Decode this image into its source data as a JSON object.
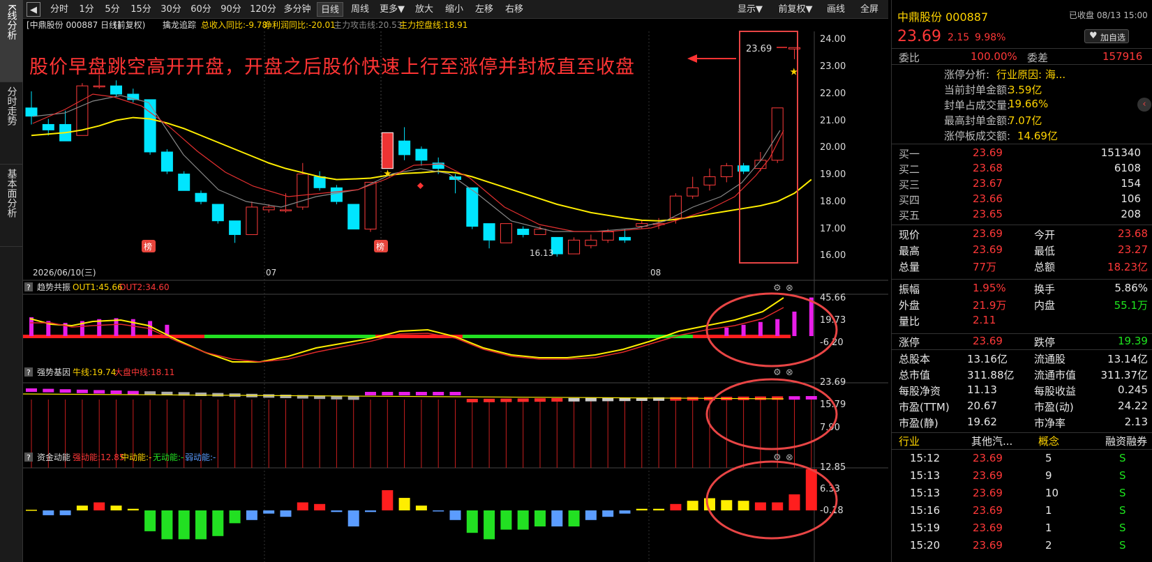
{
  "toolbar": {
    "items": [
      "分时",
      "1分",
      "5分",
      "15分",
      "30分",
      "60分",
      "90分",
      "120分",
      "多分钟",
      "日线",
      "周线",
      "更多▼",
      "放大",
      "缩小",
      "左移",
      "右移",
      "显示▼",
      "前复权▼",
      "画线",
      "全屏"
    ]
  },
  "leftbar": {
    "tabs": [
      "K线分析",
      "分时走势",
      "基本面分析"
    ]
  },
  "main_panel": {
    "header_left": "[中鼎股份 000887 日线]",
    "header_adj": "(前复权)",
    "indicator_name": "擒龙追踪",
    "ind1": "总收入同比:-9.78",
    "ind2": "净利润同比:-20.01",
    "ind3": "主力攻击线:20.53",
    "ind4": "主力控盘线:18.91",
    "annotation": "股价早盘跳空高开开盘，开盘之后股价快速上行至涨停并封板直至收盘",
    "last_price_label": "23.69",
    "low_label": "16.13",
    "rank_badge": "榜",
    "date_label": "2026/06/10(三)",
    "month_labels": [
      "07",
      "08"
    ],
    "y_ticks": [
      "24.00",
      "23.00",
      "22.00",
      "21.00",
      "20.00",
      "19.00",
      "18.00",
      "17.00",
      "16.00"
    ]
  },
  "sub1": {
    "name": "趋势共振",
    "out1": "OUT1:45.66",
    "out2": "OUT2:34.60",
    "ticks": [
      "45.66",
      "19.73",
      "-6.20"
    ]
  },
  "sub2": {
    "name": "强势基因",
    "l1": "牛线:19.74",
    "l2": "大盘中线:18.11",
    "ticks": [
      "23.69",
      "15.79",
      "7.90"
    ]
  },
  "sub3": {
    "name": "资金动能",
    "l1": "强动能:12.85",
    "l2": "中动能:-",
    "l3": "无动能:-",
    "l4": "弱动能:-",
    "ticks": [
      "12.85",
      "6.33",
      "-0.18"
    ]
  },
  "right": {
    "stock_name": "中鼎股份 000887",
    "status": "已收盘 08/13 15:00",
    "price": "23.69",
    "change": "2.15",
    "pct": "9.98%",
    "watch": "加自选",
    "webi_label": "委比",
    "webi": "100.00%",
    "weicha_label": "委差",
    "weicha": "157916",
    "limit_info": [
      {
        "k": "涨停分析:",
        "v": "行业原因: 海..."
      },
      {
        "k": "当前封单金额:",
        "v": "3.59亿"
      },
      {
        "k": "封单占成交量:",
        "v": "19.66%"
      },
      {
        "k": "最高封单金额:",
        "v": "7.07亿"
      },
      {
        "k": "涨停板成交额:",
        "v": "14.69亿"
      }
    ],
    "bids": [
      {
        "l": "买一",
        "p": "23.69",
        "v": "151340"
      },
      {
        "l": "买二",
        "p": "23.68",
        "v": "6108"
      },
      {
        "l": "买三",
        "p": "23.67",
        "v": "154"
      },
      {
        "l": "买四",
        "p": "23.66",
        "v": "106"
      },
      {
        "l": "买五",
        "p": "23.65",
        "v": "208"
      }
    ],
    "stats1": [
      {
        "k1": "现价",
        "v1": "23.69",
        "k2": "今开",
        "v2": "23.68"
      },
      {
        "k1": "最高",
        "v1": "23.69",
        "k2": "最低",
        "v2": "23.27"
      },
      {
        "k1": "总量",
        "v1": "77万",
        "k2": "总额",
        "v2": "18.23亿"
      }
    ],
    "stats2": [
      {
        "k1": "振幅",
        "v1": "1.95%",
        "k2": "换手",
        "v2": "5.86%"
      },
      {
        "k1": "外盘",
        "v1": "21.9万",
        "k2": "内盘",
        "v2": "55.1万"
      },
      {
        "k1": "量比",
        "v1": "2.11",
        "k2": "",
        "v2": ""
      }
    ],
    "limits": {
      "k1": "涨停",
      "v1": "23.69",
      "k2": "跌停",
      "v2": "19.39"
    },
    "fundamentals": [
      {
        "k1": "总股本",
        "v1": "13.16亿",
        "k2": "流通股",
        "v2": "13.14亿"
      },
      {
        "k1": "总市值",
        "v1": "311.88亿",
        "k2": "流通市值",
        "v2": "311.37亿"
      },
      {
        "k1": "每股净资",
        "v1": "11.13",
        "k2": "每股收益",
        "v2": "0.245"
      },
      {
        "k1": "市盈(TTM)",
        "v1": "20.67",
        "k2": "市盈(动)",
        "v2": "24.22"
      },
      {
        "k1": "市盈(静)",
        "v1": "19.62",
        "k2": "市净率",
        "v2": "2.13"
      }
    ],
    "industry": {
      "k1": "行业",
      "v1": "其他汽...",
      "k2": "概念",
      "v2": "融资融券"
    },
    "ticks": [
      {
        "t": "15:12",
        "p": "23.69",
        "v": "5",
        "d": "S"
      },
      {
        "t": "15:13",
        "p": "23.69",
        "v": "9",
        "d": "S"
      },
      {
        "t": "15:13",
        "p": "23.69",
        "v": "10",
        "d": "S"
      },
      {
        "t": "15:16",
        "p": "23.69",
        "v": "1",
        "d": "S"
      },
      {
        "t": "15:19",
        "p": "23.69",
        "v": "1",
        "d": "S"
      },
      {
        "t": "15:20",
        "p": "23.69",
        "v": "2",
        "d": "S"
      }
    ]
  },
  "chart_data": {
    "type": "candlestick",
    "ylim": [
      16,
      24
    ],
    "candles": [
      {
        "o": 21.5,
        "c": 21.2,
        "h": 22.1,
        "l": 20.9
      },
      {
        "o": 20.9,
        "c": 20.7,
        "h": 21.1,
        "l": 20.5
      },
      {
        "o": 20.9,
        "c": 20.3,
        "h": 21.4,
        "l": 20.3
      },
      {
        "o": 20.5,
        "c": 22.3,
        "h": 22.4,
        "l": 20.5
      },
      {
        "o": 22.3,
        "c": 22.3,
        "h": 22.7,
        "l": 22.2
      },
      {
        "o": 22.3,
        "c": 22.0,
        "h": 22.5,
        "l": 21.9
      },
      {
        "o": 22.0,
        "c": 21.8,
        "h": 22.2,
        "l": 21.7
      },
      {
        "o": 21.8,
        "c": 19.9,
        "h": 21.8,
        "l": 19.8
      },
      {
        "o": 19.9,
        "c": 19.2,
        "h": 20.0,
        "l": 19.1
      },
      {
        "o": 19.1,
        "c": 18.5,
        "h": 19.2,
        "l": 18.5
      },
      {
        "o": 18.4,
        "c": 18.1,
        "h": 18.5,
        "l": 18.0
      },
      {
        "o": 18.0,
        "c": 17.4,
        "h": 18.0,
        "l": 17.3
      },
      {
        "o": 17.4,
        "c": 16.9,
        "h": 17.4,
        "l": 16.6
      },
      {
        "o": 16.9,
        "c": 17.9,
        "h": 18.1,
        "l": 16.9
      },
      {
        "o": 17.8,
        "c": 17.9,
        "h": 18.0,
        "l": 17.7
      },
      {
        "o": 17.8,
        "c": 17.8,
        "h": 18.4,
        "l": 17.7
      },
      {
        "o": 17.9,
        "c": 19.1,
        "h": 19.5,
        "l": 17.8
      },
      {
        "o": 19.0,
        "c": 18.6,
        "h": 19.2,
        "l": 18.5
      },
      {
        "o": 18.6,
        "c": 18.1,
        "h": 18.7,
        "l": 18.0
      },
      {
        "o": 18.0,
        "c": 17.1,
        "h": 18.0,
        "l": 17.1
      },
      {
        "o": 17.1,
        "c": 18.8,
        "h": 18.8,
        "l": 17.0
      },
      {
        "o": 19.3,
        "c": 20.6,
        "h": 20.6,
        "l": 19.3
      },
      {
        "o": 20.3,
        "c": 19.8,
        "h": 20.8,
        "l": 19.6
      },
      {
        "o": 20.0,
        "c": 19.6,
        "h": 20.1,
        "l": 19.4
      },
      {
        "o": 19.5,
        "c": 19.3,
        "h": 19.7,
        "l": 19.1
      },
      {
        "o": 19.0,
        "c": 18.9,
        "h": 19.1,
        "l": 18.4
      },
      {
        "o": 18.6,
        "c": 17.2,
        "h": 18.6,
        "l": 17.1
      },
      {
        "o": 17.3,
        "c": 16.7,
        "h": 17.3,
        "l": 16.4
      },
      {
        "o": 16.6,
        "c": 17.3,
        "h": 17.3,
        "l": 16.6
      },
      {
        "o": 17.1,
        "c": 16.9,
        "h": 17.2,
        "l": 16.8
      },
      {
        "o": 16.9,
        "c": 17.1,
        "h": 17.2,
        "l": 16.9
      },
      {
        "o": 16.8,
        "c": 16.2,
        "h": 16.8,
        "l": 16.1
      },
      {
        "o": 16.2,
        "c": 16.7,
        "h": 16.8,
        "l": 16.2
      },
      {
        "o": 16.5,
        "c": 16.7,
        "h": 16.9,
        "l": 16.4
      },
      {
        "o": 16.7,
        "c": 17.0,
        "h": 17.1,
        "l": 16.6
      },
      {
        "o": 16.8,
        "c": 16.7,
        "h": 17.1,
        "l": 16.6
      },
      {
        "o": 17.2,
        "c": 17.3,
        "h": 17.4,
        "l": 17.1
      },
      {
        "o": 17.3,
        "c": 17.3,
        "h": 17.5,
        "l": 17.1
      },
      {
        "o": 17.5,
        "c": 18.3,
        "h": 18.4,
        "l": 17.3
      },
      {
        "o": 18.3,
        "c": 18.6,
        "h": 19.0,
        "l": 18.2
      },
      {
        "o": 18.7,
        "c": 19.0,
        "h": 19.3,
        "l": 18.5
      },
      {
        "o": 19.0,
        "c": 19.4,
        "h": 19.5,
        "l": 18.8
      },
      {
        "o": 19.4,
        "c": 19.2,
        "h": 19.5,
        "l": 19.1
      },
      {
        "o": 19.3,
        "c": 19.6,
        "h": 19.9,
        "l": 19.2
      },
      {
        "o": 19.6,
        "c": 21.5,
        "h": 21.5,
        "l": 19.5
      },
      {
        "o": 23.68,
        "c": 23.69,
        "h": 23.69,
        "l": 23.27
      }
    ],
    "ma_yellow": [
      20.5,
      20.55,
      20.6,
      20.7,
      20.85,
      21.05,
      21.15,
      21.1,
      20.95,
      20.75,
      20.5,
      20.25,
      20.0,
      19.75,
      19.5,
      19.3,
      19.15,
      19.0,
      18.9,
      18.92,
      18.95,
      19.05,
      19.12,
      19.15,
      19.2,
      19.15,
      19.0,
      18.8,
      18.6,
      18.4,
      18.2,
      18.0,
      17.85,
      17.7,
      17.6,
      17.5,
      17.42,
      17.4,
      17.45,
      17.55,
      17.65,
      17.75,
      17.85,
      17.95,
      18.1,
      18.4,
      18.9
    ],
    "ma_red": [
      21.2,
      21.3,
      21.4,
      21.55,
      21.7,
      21.85,
      21.85
    ]
  },
  "sub1_data": {
    "bars": [
      20,
      16,
      14,
      16,
      18,
      19,
      18,
      16,
      12,
      null,
      null,
      null,
      null,
      null,
      null,
      null,
      null,
      null,
      null,
      null,
      null,
      null,
      null,
      null,
      null,
      null,
      null,
      null,
      null,
      null,
      null,
      null,
      null,
      null,
      null,
      null,
      null,
      null,
      null,
      null,
      null,
      9,
      12,
      15,
      18,
      26,
      41
    ]
  },
  "sub3_data": {
    "bars": [
      0.2,
      -1.5,
      -1.5,
      1.5,
      2.5,
      1.5,
      0.5,
      -6.5,
      -9,
      -9,
      -9,
      -8,
      -4,
      -3,
      -1,
      -2,
      2.5,
      2,
      -0.5,
      -5,
      -0.5,
      6.3,
      3.9,
      1.5,
      -0.3,
      -3,
      -7,
      -9,
      -6,
      -6,
      -5,
      -5,
      -5,
      -3,
      -2,
      -1,
      0.5,
      0.5,
      2,
      3,
      3.8,
      3.2,
      3,
      2.5,
      2.5,
      5,
      12.85
    ]
  }
}
